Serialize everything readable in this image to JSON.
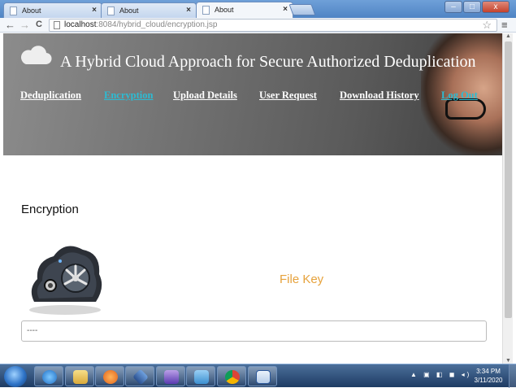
{
  "browser": {
    "tabs": [
      {
        "title": "About",
        "active": false
      },
      {
        "title": "About",
        "active": false
      },
      {
        "title": "About",
        "active": true
      }
    ],
    "close_glyph": "×",
    "nav": {
      "back": "←",
      "forward": "→",
      "reload": "C"
    },
    "url_host": "localhost",
    "url_rest": ":8084/hybrid_cloud/encryption.jsp",
    "window_buttons": {
      "minimize": "–",
      "maximize": "□",
      "close": "x"
    }
  },
  "site": {
    "title": "A Hybrid Cloud Approach for Secure Authorized Deduplication",
    "nav": [
      {
        "label": "Deduplication",
        "current": false
      },
      {
        "label": "Encryption",
        "current": true
      },
      {
        "label": "Upload Details",
        "current": false
      },
      {
        "label": "User Request",
        "current": false
      },
      {
        "label": "Download History",
        "current": false
      },
      {
        "label": "Log Out",
        "current": false
      }
    ],
    "accent_color": "#2cbcd4"
  },
  "main": {
    "heading": "Encryption",
    "file_key_label": "File Key",
    "file_key_value": "----",
    "file_key_color": "#e6a23c"
  },
  "taskbar": {
    "apps": [
      "internet-explorer-icon",
      "file-explorer-icon",
      "media-player-icon",
      "virtualbox-icon",
      "netbeans-icon",
      "notepad-icon",
      "chrome-icon",
      "word-icon"
    ],
    "time": "3:34 PM",
    "date": "3/11/2020"
  }
}
